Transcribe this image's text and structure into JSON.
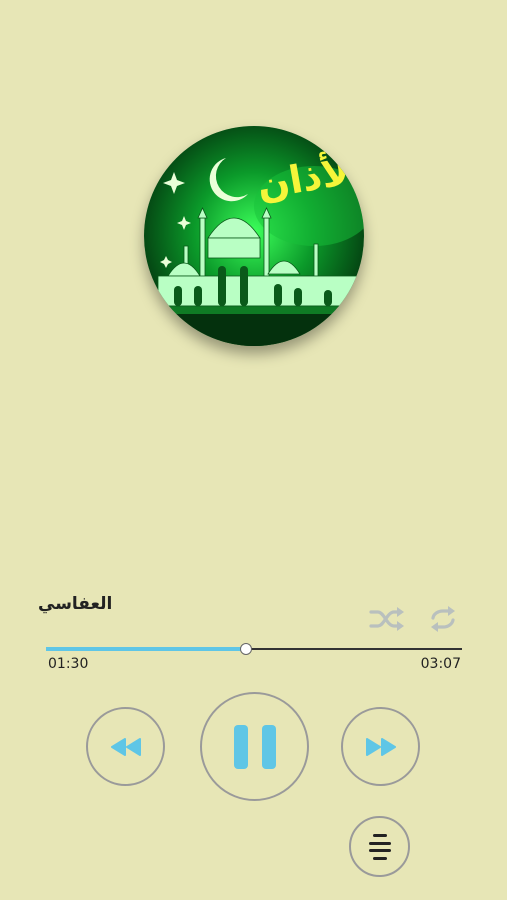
{
  "artwork": {
    "caption": "الأذان",
    "icon": "mosque-artwork"
  },
  "track": {
    "title": "العفاسي"
  },
  "modes": {
    "shuffle_icon": "shuffle-icon",
    "repeat_icon": "repeat-icon"
  },
  "progress": {
    "current": "01:30",
    "total": "03:07",
    "fraction": 0.48
  },
  "controls": {
    "previous_icon": "rewind-icon",
    "play_pause_icon": "pause-icon",
    "next_icon": "fast-forward-icon",
    "playlist_icon": "playlist-icon"
  },
  "colors": {
    "background": "#e7e6b6",
    "accent": "#5fc6e6",
    "ring": "#9a9a9a",
    "mode_icon": "#b9c0be"
  }
}
